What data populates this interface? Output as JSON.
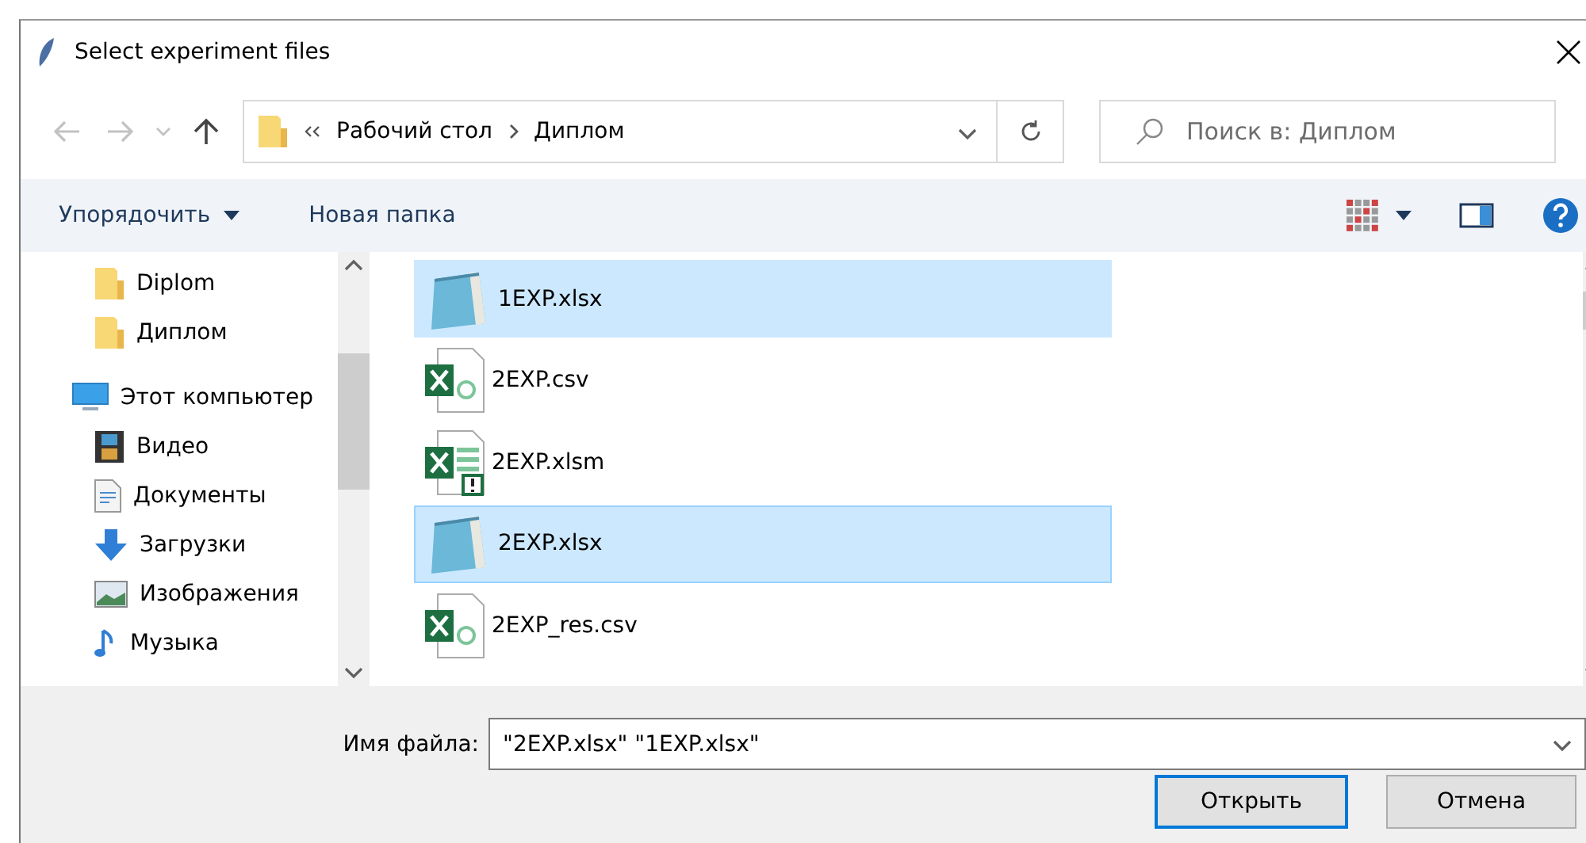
{
  "window": {
    "title": "Select experiment files"
  },
  "address": {
    "path": [
      {
        "label": "Рабочий стол"
      },
      {
        "label": "Диплом"
      }
    ]
  },
  "search": {
    "placeholder": "Поиск в: Диплом"
  },
  "toolbar": {
    "organize": "Упорядочить",
    "new_folder": "Новая папка"
  },
  "sidebar": {
    "items": [
      {
        "label": "Diplom",
        "kind": "folder"
      },
      {
        "label": "Диплом",
        "kind": "folder"
      },
      {
        "label": "Этот компьютер",
        "kind": "computer"
      },
      {
        "label": "Видео",
        "kind": "video"
      },
      {
        "label": "Документы",
        "kind": "documents"
      },
      {
        "label": "Загрузки",
        "kind": "downloads"
      },
      {
        "label": "Изображения",
        "kind": "pictures"
      },
      {
        "label": "Музыка",
        "kind": "music"
      }
    ]
  },
  "files": [
    {
      "name": "1EXP.xlsx",
      "kind": "notepad",
      "selected": true,
      "focused": false
    },
    {
      "name": "2EXP.csv",
      "kind": "csv",
      "selected": false,
      "focused": false
    },
    {
      "name": "2EXP.xlsm",
      "kind": "xlsm",
      "selected": false,
      "focused": false
    },
    {
      "name": "2EXP.xlsx",
      "kind": "notepad",
      "selected": true,
      "focused": true
    },
    {
      "name": "2EXP_res.csv",
      "kind": "csv",
      "selected": false,
      "focused": false
    }
  ],
  "footer": {
    "filename_label": "Имя файла:",
    "filename_value": "\"2EXP.xlsx\" \"1EXP.xlsx\"",
    "open": "Открыть",
    "cancel": "Отмена"
  }
}
